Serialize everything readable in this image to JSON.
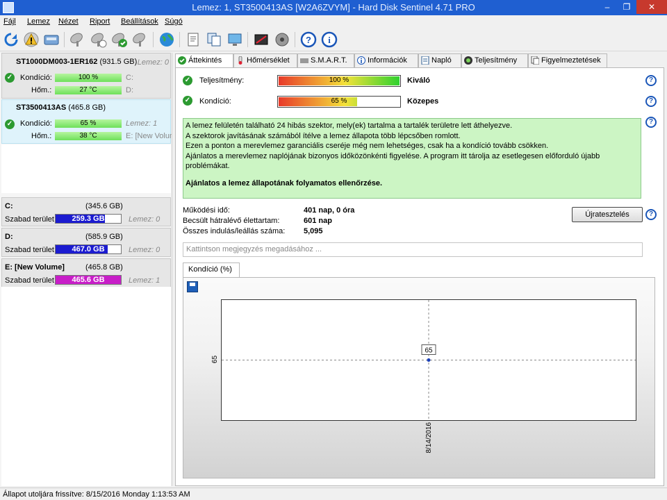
{
  "window": {
    "title": "Lemez: 1, ST3500413AS [W2A6ZVYM]  -  Hard Disk Sentinel 4.71 PRO",
    "minimize": "–",
    "maximize": "❐",
    "close": "✕"
  },
  "menu": [
    "Fájl",
    "Lemez",
    "Nézet",
    "Riport",
    "Beállítások",
    "Súgó"
  ],
  "toolbar": {
    "icons": [
      "refresh-icon",
      "alert-icon",
      "disk-icon",
      "satellite-dish-icon",
      "satellite-dish-icon",
      "satellite-dish-ok-icon",
      "satellite-dish-icon",
      "globe-icon",
      "report-icon",
      "copy-icon",
      "monitor-icon",
      "surface-test-icon",
      "disk-settings-icon",
      "help-icon",
      "info-icon"
    ]
  },
  "disks": [
    {
      "name": "ST1000DM003-1ER162",
      "size": "(931.5 GB)",
      "lemez": "Lemez: 0",
      "kondicio_label": "Kondíció:",
      "kondicio_value": "100 %",
      "kondicio_pct": 100,
      "hom_label": "Hőm.:",
      "hom_value": "27 °C",
      "part1": "C:",
      "part2": "D:"
    },
    {
      "name": "ST3500413AS",
      "size": "(465.8 GB)",
      "lemez": "Lemez: 1",
      "kondicio_label": "Kondíció:",
      "kondicio_value": "65 %",
      "kondicio_pct": 65,
      "hom_label": "Hőm.:",
      "hom_value": "38 °C",
      "part1": "Lemez: 1",
      "part2": "E: [New Volume]"
    }
  ],
  "volumes": [
    {
      "name": "C:",
      "size": "(345.6 GB)",
      "free_label": "Szabad terület",
      "free": "259.3 GB",
      "free_pct": 75,
      "lemez": "Lemez: 0",
      "color": "#1b1bd0"
    },
    {
      "name": "D:",
      "size": "(585.9 GB)",
      "free_label": "Szabad terület",
      "free": "467.0 GB",
      "free_pct": 80,
      "lemez": "Lemez: 0",
      "color": "#1b1bd0"
    },
    {
      "name": "E: [New Volume]",
      "size": "(465.8 GB)",
      "free_label": "Szabad terület",
      "free": "465.6 GB",
      "free_pct": 100,
      "lemez": "Lemez: 1",
      "color": "#c81ec8"
    }
  ],
  "tabs": [
    {
      "label": "Áttekintés",
      "icon": "check-icon",
      "active": true
    },
    {
      "label": "Hőmérséklet",
      "icon": "thermometer-icon",
      "active": false
    },
    {
      "label": "S.M.A.R.T.",
      "icon": "disk-icon",
      "active": false
    },
    {
      "label": "Információk",
      "icon": "info-icon",
      "active": false
    },
    {
      "label": "Napló",
      "icon": "log-icon",
      "active": false
    },
    {
      "label": "Teljesítmény",
      "icon": "performance-icon",
      "active": false
    },
    {
      "label": "Figyelmeztetések",
      "icon": "warnings-icon",
      "active": false
    }
  ],
  "overview": {
    "teljesitmeny_label": "Teljesítmény:",
    "teljesitmeny_value": "100 %",
    "teljesitmeny_pct": 100,
    "teljesitmeny_verdict": "Kiváló",
    "kondicio_label": "Kondíció:",
    "kondicio_value": "65 %",
    "kondicio_pct": 65,
    "kondicio_verdict": "Közepes",
    "info_lines": [
      "A lemez felületén található 24 hibás szektor, mely(ek) tartalma a tartalék területre lett áthelyezve.",
      "A szektorok javításának számából ítélve a lemez állapota több lépcsőben romlott.",
      "Ezen a ponton a merevlemez garanciális cseréje még nem lehetséges, csak ha a kondíció tovább csökken.",
      "Ajánlatos a merevlemez naplójának bizonyos időközönkénti figyelése. A program itt tárolja az esetlegesen előforduló újabb problémákat."
    ],
    "info_strong": "Ajánlatos a lemez állapotának folyamatos ellenőrzése.",
    "stats": [
      {
        "label": "Működési idő:",
        "value": "401 nap, 0 óra"
      },
      {
        "label": "Becsült hátralévő élettartam:",
        "value": "601 nap"
      },
      {
        "label": "Összes indulás/leállás száma:",
        "value": "5,095"
      }
    ],
    "retest_label": "Újratesztelés",
    "comment_placeholder": "Kattintson megjegyzés megadásához ...",
    "chart_tab_label": "Kondíció  (%)"
  },
  "chart_data": {
    "type": "line",
    "title": "Kondíció  (%)",
    "x": [
      "8/14/2016"
    ],
    "series": [
      {
        "name": "Kondíció",
        "values": [
          65
        ]
      }
    ],
    "y_tick_labels": [
      "65"
    ],
    "data_labels": [
      "65"
    ],
    "grid": true,
    "colors": {
      "point": "#1a3fb8",
      "gridline": "#888888"
    }
  },
  "statusbar": {
    "text": "Állapot utoljára frissítve: 8/15/2016 Monday 1:13:53 AM"
  }
}
